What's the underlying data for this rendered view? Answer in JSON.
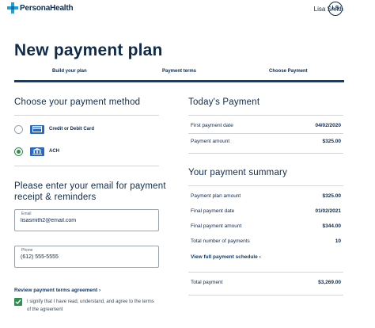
{
  "header": {
    "logo_text": "PersonaHealth",
    "user_name": "Lisa Smith",
    "avatar_initials": "LS"
  },
  "page": {
    "title": "New payment plan"
  },
  "steps": [
    {
      "label": "Build your plan"
    },
    {
      "label": "Payment terms"
    },
    {
      "label": "Choose Payment"
    }
  ],
  "payment_method": {
    "title": "Choose your payment method",
    "options": [
      {
        "label": "Credit or Debit Card",
        "icon": "credit-card-icon",
        "selected": false
      },
      {
        "label": "ACH",
        "icon": "bank-icon",
        "selected": true
      }
    ]
  },
  "contact": {
    "title_line1": "Please enter your email for payment",
    "title_line2": "receipt & reminders",
    "email_label": "Email",
    "email_value": "lisasmith2@email.com",
    "phone_label": "Phone",
    "phone_value": "(612) 555-5555"
  },
  "agreement": {
    "review_link": "Review payment terms agreement",
    "agree_line1": "I signify that I have read, understand, and agree to the terms",
    "agree_line2": "of the agreement",
    "checked": true
  },
  "todays_payment": {
    "title": "Today's Payment",
    "rows": [
      {
        "label": "First payment date",
        "value": "04/02/2020"
      },
      {
        "label": "Payment amount",
        "value": "$325.00"
      }
    ]
  },
  "summary": {
    "title": "Your payment summary",
    "rows": [
      {
        "label": "Payment plan amount",
        "value": "$325.00"
      },
      {
        "label": "Final payment date",
        "value": "01/02/2021"
      },
      {
        "label": "Final payment amount",
        "value": "$344.00"
      },
      {
        "label": "Total number of payments",
        "value": "10"
      }
    ],
    "schedule_link": "View full payment schedule",
    "total_label": "Total payment",
    "total_value": "$3,269.00"
  },
  "colors": {
    "navy": "#0f2a4a",
    "accent_blue": "#2a68c6",
    "green": "#2f8f4e",
    "progress_bar": "#0f3d6e"
  }
}
